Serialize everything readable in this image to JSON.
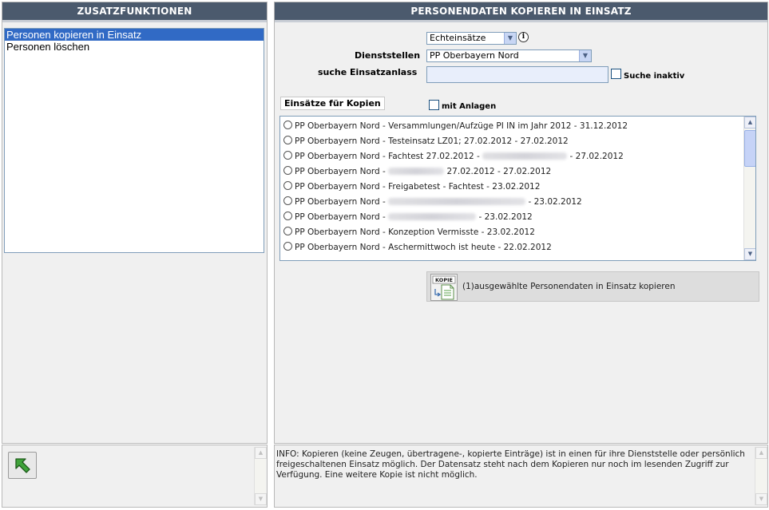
{
  "left_panel": {
    "title": "ZUSATZFUNKTIONEN",
    "items": [
      {
        "label": "Personen kopieren in Einsatz",
        "selected": true
      },
      {
        "label": "Personen löschen",
        "selected": false
      }
    ],
    "back_icon": "arrow-up-left-icon"
  },
  "right_panel": {
    "title": "PERSONENDATEN KOPIEREN IN EINSATZ",
    "einsatz_type": {
      "selected": "Echteinsätze",
      "icon": "info-icon"
    },
    "dienststellen": {
      "label": "Dienststellen",
      "selected": "PP Oberbayern Nord"
    },
    "search": {
      "label": "suche Einsatzanlass",
      "value": "",
      "inactive_label": "Suche inaktiv"
    },
    "einsaetze_header": "Einsätze für Kopien",
    "mit_anlagen_label": "mit Anlagen",
    "einsaetze": [
      {
        "a": "PP Oberbayern Nord - Versammlungen/Aufzüge PI IN im Jahr 2012 - 31.12.2012"
      },
      {
        "a": "PP Oberbayern Nord - Testeinsatz LZ01; 27.02.2012 - 27.02.2012"
      },
      {
        "a": "PP Oberbayern Nord - Fachtest 27.02.2012 - ",
        "b": " - 27.02.2012"
      },
      {
        "a": "PP Oberbayern Nord - ",
        "b": " 27.02.2012 - 27.02.2012"
      },
      {
        "a": "PP Oberbayern Nord - Freigabetest - Fachtest - 23.02.2012"
      },
      {
        "a": "PP Oberbayern Nord - ",
        "b": " - 23.02.2012"
      },
      {
        "a": "PP Oberbayern Nord - ",
        "b": " - 23.02.2012"
      },
      {
        "a": "PP Oberbayern Nord - Konzeption Vermisste - 23.02.2012"
      },
      {
        "a": "PP Oberbayern Nord - Aschermittwoch ist heute - 22.02.2012"
      }
    ],
    "copy": {
      "badge": "KOPIE",
      "label": "(1)ausgewählte Personendaten in Einsatz kopieren"
    }
  },
  "info": {
    "text": "INFO: Kopieren (keine Zeugen, übertragene-, kopierte Einträge) ist in einen für ihre Dienststelle oder persönlich freigeschaltenen Einsatz möglich. Der Datensatz steht nach dem Kopieren nur noch im lesenden Zugriff zur Verfügung. Eine weitere Kopie ist nicht möglich."
  }
}
